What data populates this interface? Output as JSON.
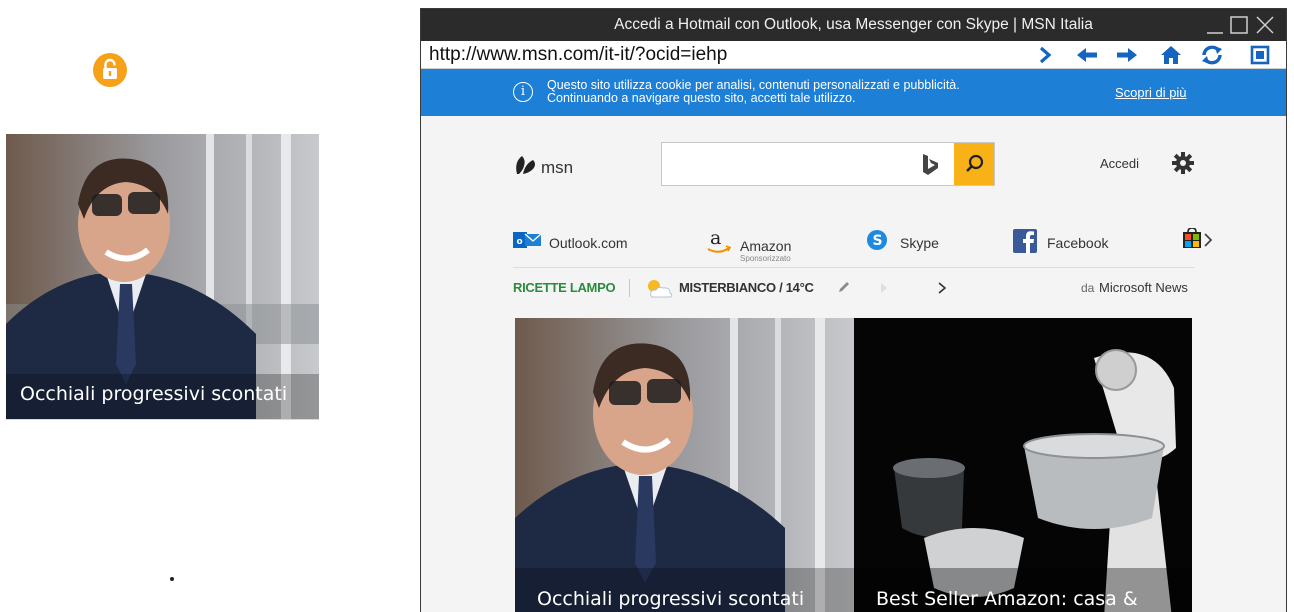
{
  "left_panel": {
    "lock_icon": "unlocked-padlock-icon",
    "card_caption": "Occhiali progressivi scontati"
  },
  "window": {
    "title": "Accedi a Hotmail con Outlook, usa Messenger con Skype | MSN Italia",
    "controls": [
      "minimize-icon",
      "maximize-icon",
      "close-icon"
    ]
  },
  "urlbar": {
    "url": "http://www.msn.com/it-it/?ocid=iehp",
    "buttons": [
      "go-icon",
      "back-icon",
      "forward-icon",
      "home-icon",
      "refresh-icon",
      "screenshot-icon"
    ]
  },
  "cookie_banner": {
    "line1": "Questo sito utilizza cookie per analisi, contenuti personalizzati e pubblicità.",
    "line2": "Continuando a navigare questo sito, accetti tale utilizzo.",
    "link": "Scopri di più"
  },
  "header": {
    "logo": "msn",
    "search_placeholder": "",
    "signin": "Accedi"
  },
  "quick_links": [
    {
      "label": "Outlook.com",
      "icon": "outlook-icon"
    },
    {
      "label": "Amazon",
      "sub": "Sponsorizzato",
      "icon": "amazon-icon"
    },
    {
      "label": "Skype",
      "icon": "skype-icon"
    },
    {
      "label": "Facebook",
      "icon": "facebook-icon"
    },
    {
      "label": "",
      "icon": "store-icon"
    }
  ],
  "info_strip": {
    "section": "RICETTE LAMPO",
    "weather": "MISTERBIANCO / 14°C",
    "source_prefix": "da",
    "source": "Microsoft News"
  },
  "tiles": [
    {
      "caption": "Occhiali progressivi scontati"
    },
    {
      "caption": "Best Seller Amazon: casa &"
    }
  ],
  "colors": {
    "titlebar": "#2b2b2b",
    "cookie_banner": "#1e7fd6",
    "search_button": "#f8b117",
    "lock": "#f7a11a",
    "ricette_green": "#2b8a3e"
  }
}
